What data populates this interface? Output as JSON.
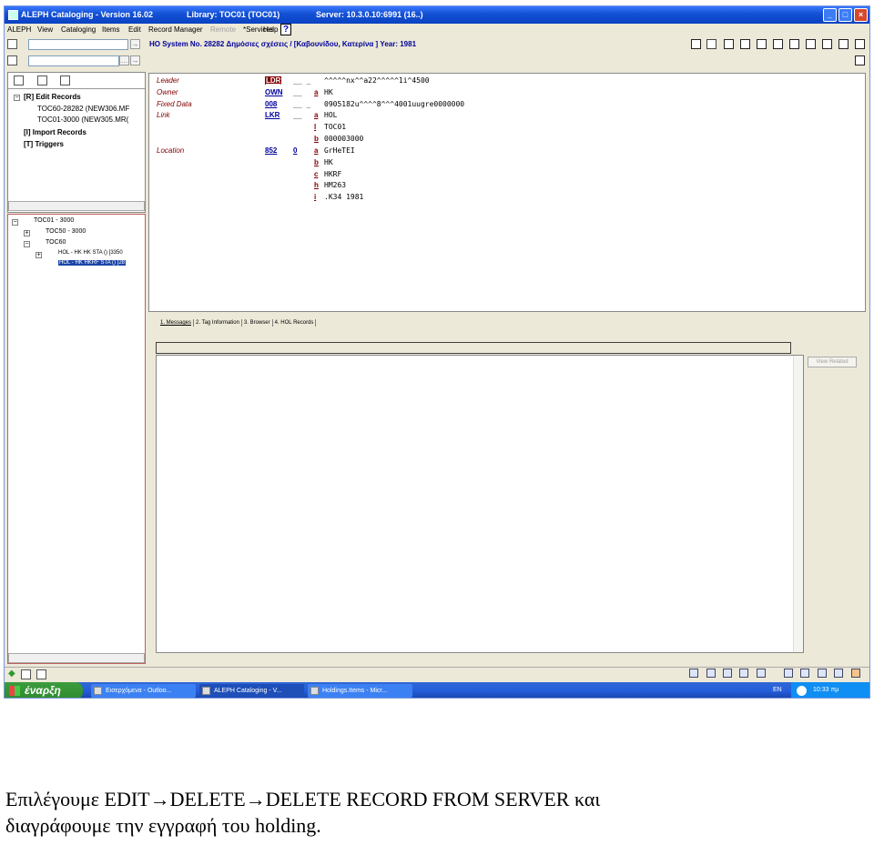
{
  "window": {
    "title": "ALEPH Cataloging - Version 16.02",
    "library": "Library:  TOC01 (TOC01)",
    "server": "Server:  10.3.0.10:6991 (16..)",
    "controls": [
      "_",
      "□",
      "×"
    ]
  },
  "menu": {
    "items": [
      "ALEPH",
      "View",
      "Cataloging",
      "Items",
      "Edit",
      "Record Manager",
      "Remote",
      "*Services",
      "Help"
    ],
    "disabled": "Remote",
    "help_icon": "?"
  },
  "toolbar": {
    "system_no": "HO System No. 28282 Δημόσιες σχέσεις / [Καβουνίδου, Κατερίνα  ] Year: 1981",
    "icons": [
      "new-icon",
      "tools-icon",
      "table-icon",
      "list-icon",
      "pencil-icon",
      "check-icon",
      "split-icon",
      "mail-icon",
      "save-icon",
      "close-doc-icon",
      "delete-icon"
    ],
    "row2_icon": "save-icon"
  },
  "left_panel": {
    "tabs": [
      "file-icon",
      "pages-icon",
      "binoculars-icon"
    ],
    "tree": [
      {
        "label": "[R] Edit Records",
        "bold": true
      },
      {
        "label": "TOC60-28282 (NEW306.MF",
        "bold": false
      },
      {
        "label": "TOC01-3000 (NEW305.MR(",
        "bold": false
      },
      {
        "label": "[I] Import Records",
        "bold": true
      },
      {
        "label": "[T] Triggers",
        "bold": true
      }
    ],
    "nav_tree": [
      {
        "label": "TOC01 - 3000"
      },
      {
        "label": "TOC50 - 3000"
      },
      {
        "label": "TOC60"
      },
      {
        "label": "HOL - HK HK STA () [3350"
      },
      {
        "label": "HOL - HK HKRF STA () [28"
      }
    ]
  },
  "editor": {
    "fields": [
      {
        "label": "Leader",
        "tag": "LDR",
        "ind": "__ _",
        "sub": "",
        "value": "^^^^^nx^^a22^^^^^1i^4500"
      },
      {
        "label": "Owner",
        "tag": "OWN",
        "ind": "__",
        "sub": "a",
        "value": "HK"
      },
      {
        "label": "Fixed Data",
        "tag": "008",
        "ind": "__ _",
        "sub": "",
        "value": "0905182u^^^^8^^^4001uugre0000000"
      },
      {
        "label": "Link",
        "tag": "LKR",
        "ind": "__",
        "sub": "a",
        "value": "HOL"
      },
      {
        "label": "",
        "tag": "",
        "ind": "",
        "sub": "l",
        "value": "TOC01"
      },
      {
        "label": "",
        "tag": "",
        "ind": "",
        "sub": "b",
        "value": "000003000"
      },
      {
        "label": "Location",
        "tag": "852",
        "ind": "0",
        "sub": "a",
        "value": "GrHeTEI"
      },
      {
        "label": "",
        "tag": "",
        "ind": "",
        "sub": "b",
        "value": "HK"
      },
      {
        "label": "",
        "tag": "",
        "ind": "",
        "sub": "c",
        "value": "HKRF"
      },
      {
        "label": "",
        "tag": "",
        "ind": "",
        "sub": "h",
        "value": "HM263"
      },
      {
        "label": "",
        "tag": "",
        "ind": "",
        "sub": "i",
        "value": ".K34 1981"
      }
    ]
  },
  "bottom_tabs": [
    "1. Messages",
    "2. Tag Information",
    "3. Browser",
    "4. HOL Records"
  ],
  "view_related": "View Related",
  "taskbar": {
    "start": "έναρξη",
    "tasks": [
      "Εισερχόμενα - Outloo...",
      "ALEPH Cataloging - V...",
      "Holdings.Items - Micr..."
    ],
    "lang": "EN",
    "clock": "10:33 πμ"
  },
  "caption": {
    "line1": "Επιλέγουμε EDIT→DELETE→DELETE RECORD FROM SERVER και",
    "line2": "διαγράφουμε την εγγραφή του holding."
  }
}
